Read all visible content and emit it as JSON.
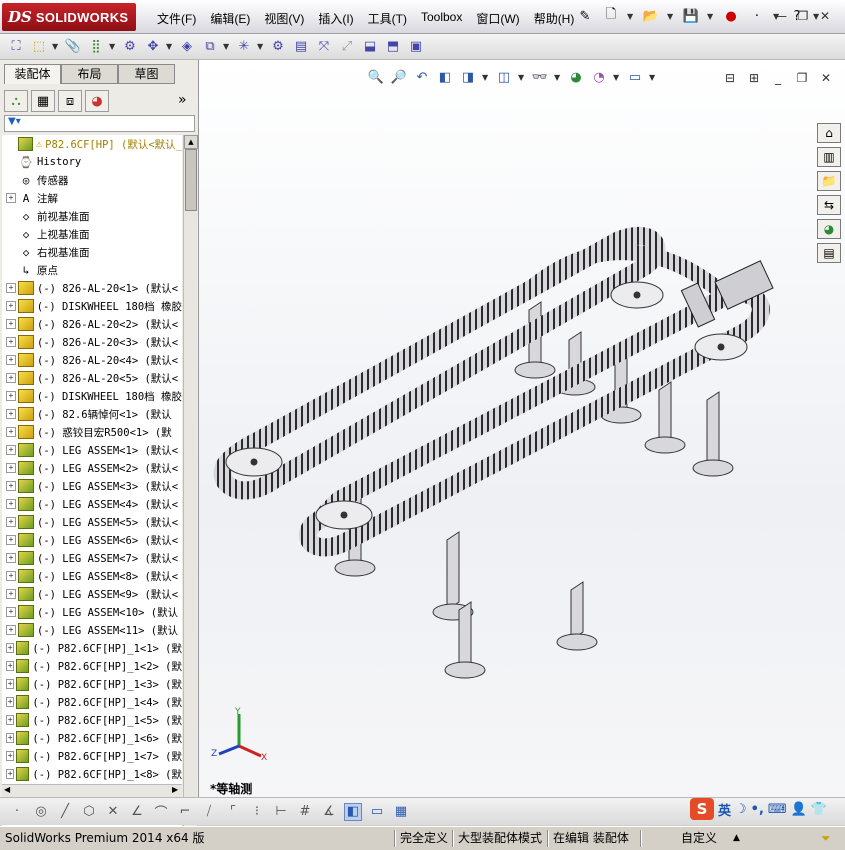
{
  "app": {
    "logo_ds": "DS",
    "logo_name": "SOLIDWORKS"
  },
  "menu": [
    "文件(F)",
    "编辑(E)",
    "视图(V)",
    "插入(I)",
    "工具(T)",
    "Toolbox",
    "窗口(W)",
    "帮助(H)"
  ],
  "panel": {
    "tabs": [
      "装配体",
      "布局",
      "草图"
    ],
    "expand_icon": "»",
    "filter_icon": "funnel-icon"
  },
  "tree": [
    {
      "label": "P82.6CF[HP]  (默认<默认_",
      "exp": false,
      "icon": "asm",
      "root": true
    },
    {
      "label": "History",
      "exp": false,
      "icon": "history"
    },
    {
      "label": "传感器",
      "exp": false,
      "icon": "sensor"
    },
    {
      "label": "注解",
      "exp": true,
      "icon": "annotation"
    },
    {
      "label": "前视基准面",
      "exp": false,
      "icon": "plane"
    },
    {
      "label": "上视基准面",
      "exp": false,
      "icon": "plane"
    },
    {
      "label": "右视基准面",
      "exp": false,
      "icon": "plane"
    },
    {
      "label": "原点",
      "exp": false,
      "icon": "origin"
    },
    {
      "label": "(-) 826-AL-20<1> (默认<",
      "exp": true,
      "icon": "part"
    },
    {
      "label": "(-) DISKWHEEL 180档 橡胶",
      "exp": true,
      "icon": "part"
    },
    {
      "label": "(-) 826-AL-20<2> (默认<",
      "exp": true,
      "icon": "part"
    },
    {
      "label": "(-) 826-AL-20<3> (默认<",
      "exp": true,
      "icon": "part"
    },
    {
      "label": "(-) 826-AL-20<4> (默认<",
      "exp": true,
      "icon": "part"
    },
    {
      "label": "(-) 826-AL-20<5> (默认<",
      "exp": true,
      "icon": "part"
    },
    {
      "label": "(-) DISKWHEEL 180档 橡胶",
      "exp": true,
      "icon": "part"
    },
    {
      "label": "(-) 82.6辆悼何<1> (默认",
      "exp": true,
      "icon": "part"
    },
    {
      "label": "(-) 惑铰目宏R500<1> (默",
      "exp": true,
      "icon": "part"
    },
    {
      "label": "(-) LEG ASSEM<1> (默认<",
      "exp": true,
      "icon": "asm"
    },
    {
      "label": "(-) LEG ASSEM<2> (默认<",
      "exp": true,
      "icon": "asm"
    },
    {
      "label": "(-) LEG ASSEM<3> (默认<",
      "exp": true,
      "icon": "asm"
    },
    {
      "label": "(-) LEG ASSEM<4> (默认<",
      "exp": true,
      "icon": "asm"
    },
    {
      "label": "(-) LEG ASSEM<5> (默认<",
      "exp": true,
      "icon": "asm"
    },
    {
      "label": "(-) LEG ASSEM<6> (默认<",
      "exp": true,
      "icon": "asm"
    },
    {
      "label": "(-) LEG ASSEM<7> (默认<",
      "exp": true,
      "icon": "asm"
    },
    {
      "label": "(-) LEG ASSEM<8> (默认<",
      "exp": true,
      "icon": "asm"
    },
    {
      "label": "(-) LEG ASSEM<9> (默认<",
      "exp": true,
      "icon": "asm"
    },
    {
      "label": "(-) LEG ASSEM<10> (默认",
      "exp": true,
      "icon": "asm"
    },
    {
      "label": "(-) LEG ASSEM<11> (默认",
      "exp": true,
      "icon": "asm"
    },
    {
      "label": "(-) P82.6CF[HP]_1<1> (默",
      "exp": true,
      "icon": "asm"
    },
    {
      "label": "(-) P82.6CF[HP]_1<2> (默",
      "exp": true,
      "icon": "asm"
    },
    {
      "label": "(-) P82.6CF[HP]_1<3> (默",
      "exp": true,
      "icon": "asm"
    },
    {
      "label": "(-) P82.6CF[HP]_1<4> (默",
      "exp": true,
      "icon": "asm"
    },
    {
      "label": "(-) P82.6CF[HP]_1<5> (默",
      "exp": true,
      "icon": "asm"
    },
    {
      "label": "(-) P82.6CF[HP]_1<6> (默",
      "exp": true,
      "icon": "asm"
    },
    {
      "label": "(-) P82.6CF[HP]_1<7> (默",
      "exp": true,
      "icon": "asm"
    },
    {
      "label": "(-) P82.6CF[HP]_1<8> (默",
      "exp": true,
      "icon": "asm"
    }
  ],
  "viewport": {
    "view_label": "*等轴测",
    "triad": {
      "x": "X",
      "y": "Y",
      "z": "Z"
    }
  },
  "ime": {
    "logo": "S",
    "lang": "英"
  },
  "status": {
    "product": "SolidWorks Premium 2014 x64 版",
    "definition": "完全定义",
    "mode": "大型装配体模式",
    "editing": "在编辑 装配体",
    "units": "自定义"
  }
}
